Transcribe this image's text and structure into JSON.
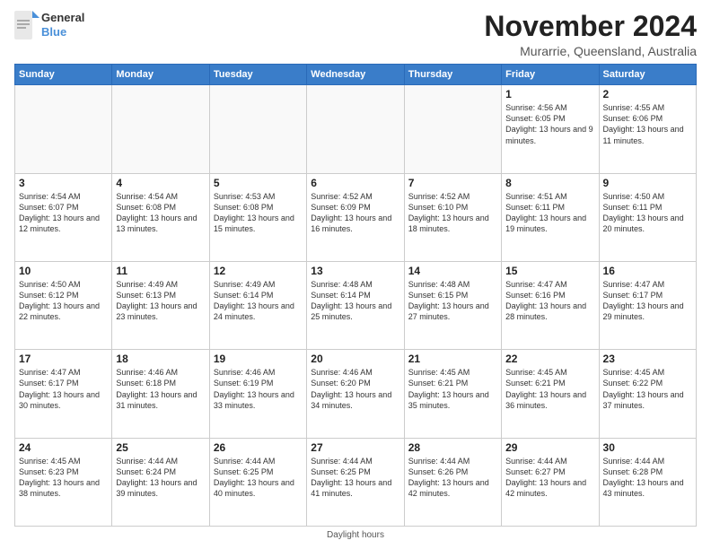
{
  "header": {
    "logo_general": "General",
    "logo_blue": "Blue",
    "month_title": "November 2024",
    "location": "Murarrie, Queensland, Australia"
  },
  "days_of_week": [
    "Sunday",
    "Monday",
    "Tuesday",
    "Wednesday",
    "Thursday",
    "Friday",
    "Saturday"
  ],
  "footer": {
    "daylight_label": "Daylight hours"
  },
  "weeks": [
    [
      {
        "day": "",
        "sunrise": "",
        "sunset": "",
        "daylight": "",
        "empty": true
      },
      {
        "day": "",
        "sunrise": "",
        "sunset": "",
        "daylight": "",
        "empty": true
      },
      {
        "day": "",
        "sunrise": "",
        "sunset": "",
        "daylight": "",
        "empty": true
      },
      {
        "day": "",
        "sunrise": "",
        "sunset": "",
        "daylight": "",
        "empty": true
      },
      {
        "day": "",
        "sunrise": "",
        "sunset": "",
        "daylight": "",
        "empty": true
      },
      {
        "day": "1",
        "sunrise": "Sunrise: 4:56 AM",
        "sunset": "Sunset: 6:05 PM",
        "daylight": "Daylight: 13 hours and 9 minutes.",
        "empty": false
      },
      {
        "day": "2",
        "sunrise": "Sunrise: 4:55 AM",
        "sunset": "Sunset: 6:06 PM",
        "daylight": "Daylight: 13 hours and 11 minutes.",
        "empty": false
      }
    ],
    [
      {
        "day": "3",
        "sunrise": "Sunrise: 4:54 AM",
        "sunset": "Sunset: 6:07 PM",
        "daylight": "Daylight: 13 hours and 12 minutes.",
        "empty": false
      },
      {
        "day": "4",
        "sunrise": "Sunrise: 4:54 AM",
        "sunset": "Sunset: 6:08 PM",
        "daylight": "Daylight: 13 hours and 13 minutes.",
        "empty": false
      },
      {
        "day": "5",
        "sunrise": "Sunrise: 4:53 AM",
        "sunset": "Sunset: 6:08 PM",
        "daylight": "Daylight: 13 hours and 15 minutes.",
        "empty": false
      },
      {
        "day": "6",
        "sunrise": "Sunrise: 4:52 AM",
        "sunset": "Sunset: 6:09 PM",
        "daylight": "Daylight: 13 hours and 16 minutes.",
        "empty": false
      },
      {
        "day": "7",
        "sunrise": "Sunrise: 4:52 AM",
        "sunset": "Sunset: 6:10 PM",
        "daylight": "Daylight: 13 hours and 18 minutes.",
        "empty": false
      },
      {
        "day": "8",
        "sunrise": "Sunrise: 4:51 AM",
        "sunset": "Sunset: 6:11 PM",
        "daylight": "Daylight: 13 hours and 19 minutes.",
        "empty": false
      },
      {
        "day": "9",
        "sunrise": "Sunrise: 4:50 AM",
        "sunset": "Sunset: 6:11 PM",
        "daylight": "Daylight: 13 hours and 20 minutes.",
        "empty": false
      }
    ],
    [
      {
        "day": "10",
        "sunrise": "Sunrise: 4:50 AM",
        "sunset": "Sunset: 6:12 PM",
        "daylight": "Daylight: 13 hours and 22 minutes.",
        "empty": false
      },
      {
        "day": "11",
        "sunrise": "Sunrise: 4:49 AM",
        "sunset": "Sunset: 6:13 PM",
        "daylight": "Daylight: 13 hours and 23 minutes.",
        "empty": false
      },
      {
        "day": "12",
        "sunrise": "Sunrise: 4:49 AM",
        "sunset": "Sunset: 6:14 PM",
        "daylight": "Daylight: 13 hours and 24 minutes.",
        "empty": false
      },
      {
        "day": "13",
        "sunrise": "Sunrise: 4:48 AM",
        "sunset": "Sunset: 6:14 PM",
        "daylight": "Daylight: 13 hours and 25 minutes.",
        "empty": false
      },
      {
        "day": "14",
        "sunrise": "Sunrise: 4:48 AM",
        "sunset": "Sunset: 6:15 PM",
        "daylight": "Daylight: 13 hours and 27 minutes.",
        "empty": false
      },
      {
        "day": "15",
        "sunrise": "Sunrise: 4:47 AM",
        "sunset": "Sunset: 6:16 PM",
        "daylight": "Daylight: 13 hours and 28 minutes.",
        "empty": false
      },
      {
        "day": "16",
        "sunrise": "Sunrise: 4:47 AM",
        "sunset": "Sunset: 6:17 PM",
        "daylight": "Daylight: 13 hours and 29 minutes.",
        "empty": false
      }
    ],
    [
      {
        "day": "17",
        "sunrise": "Sunrise: 4:47 AM",
        "sunset": "Sunset: 6:17 PM",
        "daylight": "Daylight: 13 hours and 30 minutes.",
        "empty": false
      },
      {
        "day": "18",
        "sunrise": "Sunrise: 4:46 AM",
        "sunset": "Sunset: 6:18 PM",
        "daylight": "Daylight: 13 hours and 31 minutes.",
        "empty": false
      },
      {
        "day": "19",
        "sunrise": "Sunrise: 4:46 AM",
        "sunset": "Sunset: 6:19 PM",
        "daylight": "Daylight: 13 hours and 33 minutes.",
        "empty": false
      },
      {
        "day": "20",
        "sunrise": "Sunrise: 4:46 AM",
        "sunset": "Sunset: 6:20 PM",
        "daylight": "Daylight: 13 hours and 34 minutes.",
        "empty": false
      },
      {
        "day": "21",
        "sunrise": "Sunrise: 4:45 AM",
        "sunset": "Sunset: 6:21 PM",
        "daylight": "Daylight: 13 hours and 35 minutes.",
        "empty": false
      },
      {
        "day": "22",
        "sunrise": "Sunrise: 4:45 AM",
        "sunset": "Sunset: 6:21 PM",
        "daylight": "Daylight: 13 hours and 36 minutes.",
        "empty": false
      },
      {
        "day": "23",
        "sunrise": "Sunrise: 4:45 AM",
        "sunset": "Sunset: 6:22 PM",
        "daylight": "Daylight: 13 hours and 37 minutes.",
        "empty": false
      }
    ],
    [
      {
        "day": "24",
        "sunrise": "Sunrise: 4:45 AM",
        "sunset": "Sunset: 6:23 PM",
        "daylight": "Daylight: 13 hours and 38 minutes.",
        "empty": false
      },
      {
        "day": "25",
        "sunrise": "Sunrise: 4:44 AM",
        "sunset": "Sunset: 6:24 PM",
        "daylight": "Daylight: 13 hours and 39 minutes.",
        "empty": false
      },
      {
        "day": "26",
        "sunrise": "Sunrise: 4:44 AM",
        "sunset": "Sunset: 6:25 PM",
        "daylight": "Daylight: 13 hours and 40 minutes.",
        "empty": false
      },
      {
        "day": "27",
        "sunrise": "Sunrise: 4:44 AM",
        "sunset": "Sunset: 6:25 PM",
        "daylight": "Daylight: 13 hours and 41 minutes.",
        "empty": false
      },
      {
        "day": "28",
        "sunrise": "Sunrise: 4:44 AM",
        "sunset": "Sunset: 6:26 PM",
        "daylight": "Daylight: 13 hours and 42 minutes.",
        "empty": false
      },
      {
        "day": "29",
        "sunrise": "Sunrise: 4:44 AM",
        "sunset": "Sunset: 6:27 PM",
        "daylight": "Daylight: 13 hours and 42 minutes.",
        "empty": false
      },
      {
        "day": "30",
        "sunrise": "Sunrise: 4:44 AM",
        "sunset": "Sunset: 6:28 PM",
        "daylight": "Daylight: 13 hours and 43 minutes.",
        "empty": false
      }
    ]
  ]
}
